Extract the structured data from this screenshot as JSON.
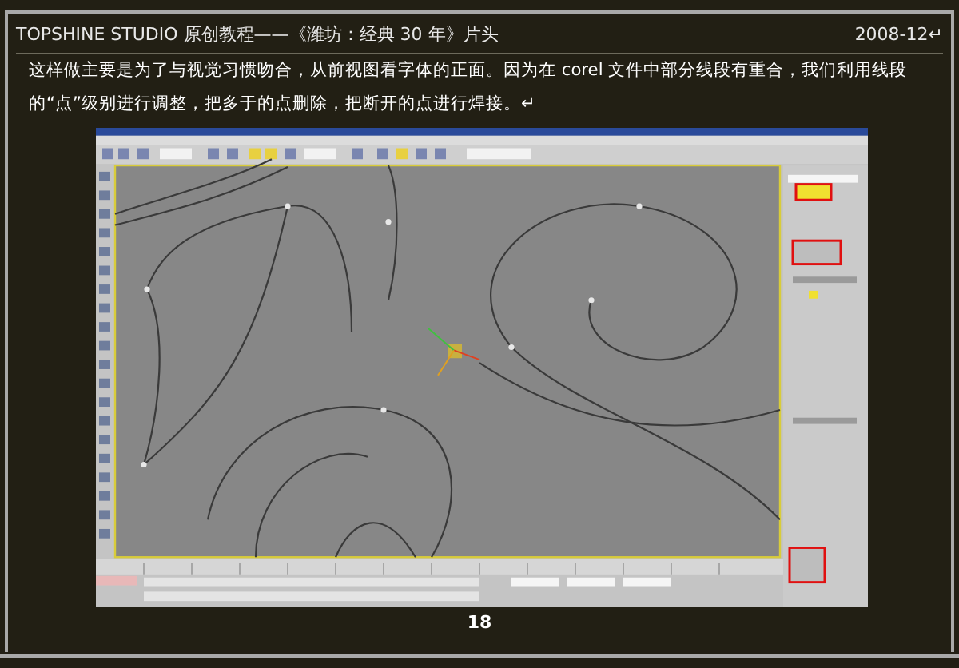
{
  "header": {
    "title": "TOPSHINE STUDIO 原创教程——《潍坊：经典 30 年》片头",
    "date": "2008-12↵"
  },
  "paragraph": "这样做主要是为了与视觉习惯吻合，从前视图看字体的正面。因为在 corel 文件中部分线段有重合，我们利用线段的“点”级别进行调整，把多于的点删除，把断开的点进行焊接。↵",
  "page_number": "18"
}
